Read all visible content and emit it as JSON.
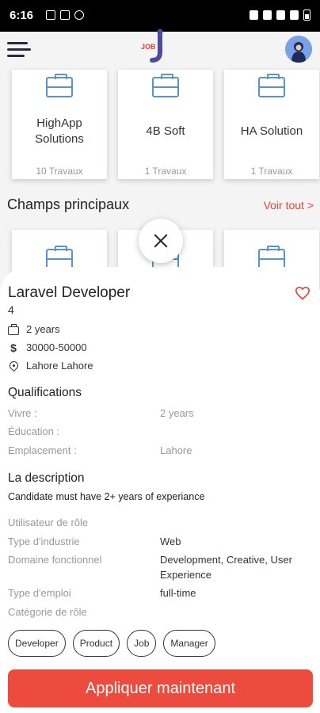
{
  "status_bar": {
    "time": "6:16"
  },
  "header": {
    "logo_text": "JOB"
  },
  "companies": [
    {
      "name": "HighApp Solutions",
      "count": "10 Travaux"
    },
    {
      "name": "4B Soft",
      "count": "1 Travaux"
    },
    {
      "name": "HA Solution",
      "count": "1 Travaux"
    }
  ],
  "fields_section": {
    "title": "Champs principaux",
    "see_all": "Voir tout >"
  },
  "job": {
    "title": "Laravel Developer",
    "subtitle": "4",
    "experience": "2 years",
    "salary": "30000-50000",
    "location": "Lahore  Lahore"
  },
  "qualifications": {
    "heading": "Qualifications",
    "experience_label": "Vivre :",
    "experience_value": "2 years",
    "education_label": "Éducation :",
    "location_label": "Emplacement :",
    "location_value": "Lahore"
  },
  "description": {
    "heading": "La description",
    "text": "Candidate must have 2+ years of experiance",
    "role_user_label": "Utilisateur de rôle",
    "industry_label": "Type d'industrie",
    "industry_value": "Web",
    "functional_label": "Domaine fonctionnel",
    "functional_value": "Development, Creative, User Experience",
    "employment_label": "Type d'emploi",
    "employment_value": "full-time",
    "role_category_label": "Catégorie de rôle"
  },
  "tags": [
    "Developer",
    "Product",
    "Job",
    "Manager"
  ],
  "apply_label": "Appliquer maintenant",
  "colors": {
    "accent": "#ec4b3d",
    "icon_blue": "#5a94c8"
  }
}
